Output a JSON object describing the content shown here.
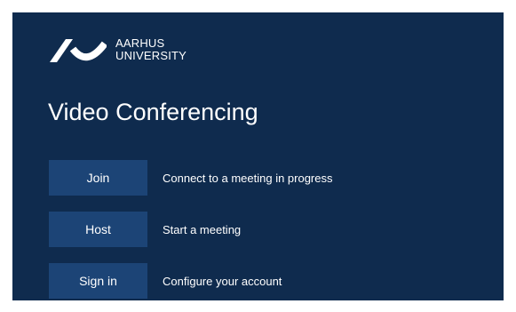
{
  "brand": {
    "line1": "AARHUS",
    "line2": "UNIVERSITY"
  },
  "title": "Video Conferencing",
  "actions": [
    {
      "label": "Join",
      "description": "Connect to a meeting in progress"
    },
    {
      "label": "Host",
      "description": "Start a meeting"
    },
    {
      "label": "Sign in",
      "description": "Configure your account"
    }
  ],
  "colors": {
    "background": "#0f2b4e",
    "button": "#1c4476",
    "text": "#ffffff"
  }
}
